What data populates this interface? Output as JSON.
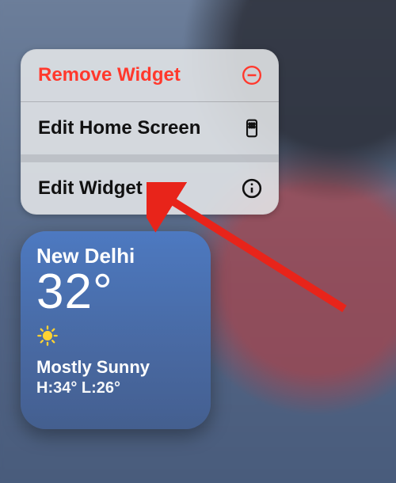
{
  "colors": {
    "destructive": "#ff3b30"
  },
  "menu": {
    "remove_label": "Remove Widget",
    "edit_home_label": "Edit Home Screen",
    "edit_widget_label": "Edit Widget"
  },
  "weather": {
    "city": "New Delhi",
    "temp": "32°",
    "condition": "Mostly Sunny",
    "hl": "H:34° L:26°",
    "icon": "sun-icon"
  }
}
